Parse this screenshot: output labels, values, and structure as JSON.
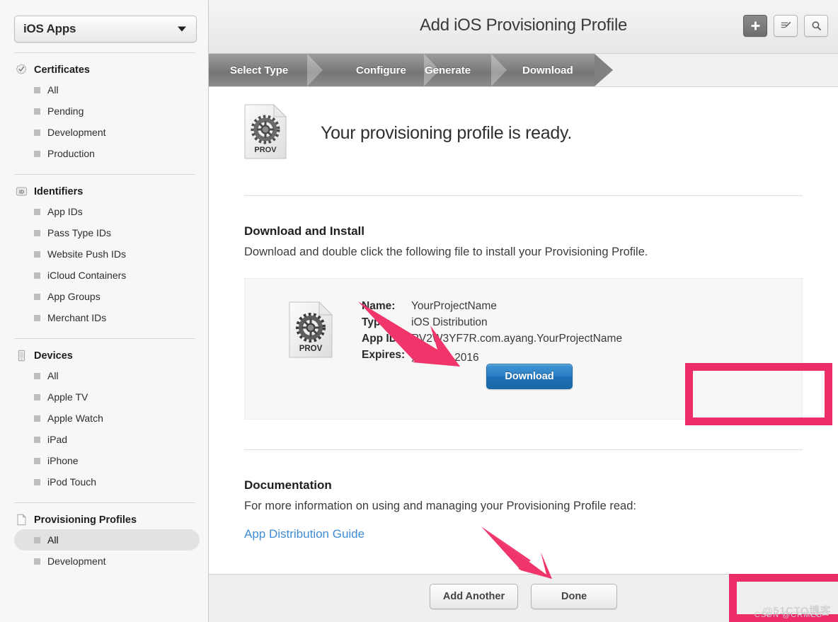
{
  "sidebar": {
    "org_selector": {
      "value": "iOS Apps",
      "icon": "chevron-down-icon"
    },
    "groups": [
      {
        "title": "Certificates",
        "icon": "certificate-seal-icon",
        "items": [
          {
            "label": "All",
            "selected": false
          },
          {
            "label": "Pending",
            "selected": false
          },
          {
            "label": "Development",
            "selected": false
          },
          {
            "label": "Production",
            "selected": false
          }
        ]
      },
      {
        "title": "Identifiers",
        "icon": "id-badge-icon",
        "items": [
          {
            "label": "App IDs",
            "selected": false
          },
          {
            "label": "Pass Type IDs",
            "selected": false
          },
          {
            "label": "Website Push IDs",
            "selected": false
          },
          {
            "label": "iCloud Containers",
            "selected": false
          },
          {
            "label": "App Groups",
            "selected": false
          },
          {
            "label": "Merchant IDs",
            "selected": false
          }
        ]
      },
      {
        "title": "Devices",
        "icon": "device-phone-icon",
        "items": [
          {
            "label": "All",
            "selected": false
          },
          {
            "label": "Apple TV",
            "selected": false
          },
          {
            "label": "Apple Watch",
            "selected": false
          },
          {
            "label": "iPad",
            "selected": false
          },
          {
            "label": "iPhone",
            "selected": false
          },
          {
            "label": "iPod Touch",
            "selected": false
          }
        ]
      },
      {
        "title": "Provisioning Profiles",
        "icon": "document-icon",
        "items": [
          {
            "label": "All",
            "selected": true
          },
          {
            "label": "Development",
            "selected": false
          }
        ]
      }
    ]
  },
  "header": {
    "title": "Add iOS Provisioning Profile",
    "buttons": [
      {
        "name": "add-button",
        "icon": "plus-icon",
        "active": true
      },
      {
        "name": "edit-button",
        "icon": "pencil-edit-icon",
        "active": false
      },
      {
        "name": "search-button",
        "icon": "search-icon",
        "active": false
      }
    ]
  },
  "steps": {
    "items": [
      {
        "label": "Select Type",
        "active": false
      },
      {
        "label": "Configure",
        "active": false
      },
      {
        "label": "Generate",
        "active": false
      },
      {
        "label": "Download",
        "active": true
      }
    ]
  },
  "main": {
    "file_icon_label": "PROV",
    "ready_heading": "Your provisioning profile is ready.",
    "download_section": {
      "title": "Download and Install",
      "subtitle": "Download and double click the following file to install your Provisioning Profile.",
      "file": {
        "icon_label": "PROV",
        "fields": [
          {
            "key": "Name:",
            "value": "YourProjectName"
          },
          {
            "key": "Type:",
            "value": "iOS Distribution"
          },
          {
            "key": "App ID:",
            "value": "RV2W3YF7R.com.ayang.YourProjectName"
          },
          {
            "key": "Expires:",
            "value": "六月 23, 2016"
          }
        ]
      },
      "download_button": "Download"
    },
    "documentation_section": {
      "title": "Documentation",
      "subtitle": "For more information on using and managing your Provisioning Profile read:",
      "link": "App Distribution Guide"
    }
  },
  "footer": {
    "add_another_label": "Add Another",
    "done_label": "Done"
  },
  "annotations": {
    "color": "#ec2d68",
    "arrow_color": "#f0356b",
    "highlighted": [
      "Download",
      "Done"
    ]
  },
  "watermark": {
    "primary": "@51CTO博客",
    "secondary": "CSDN @CRMEB"
  }
}
